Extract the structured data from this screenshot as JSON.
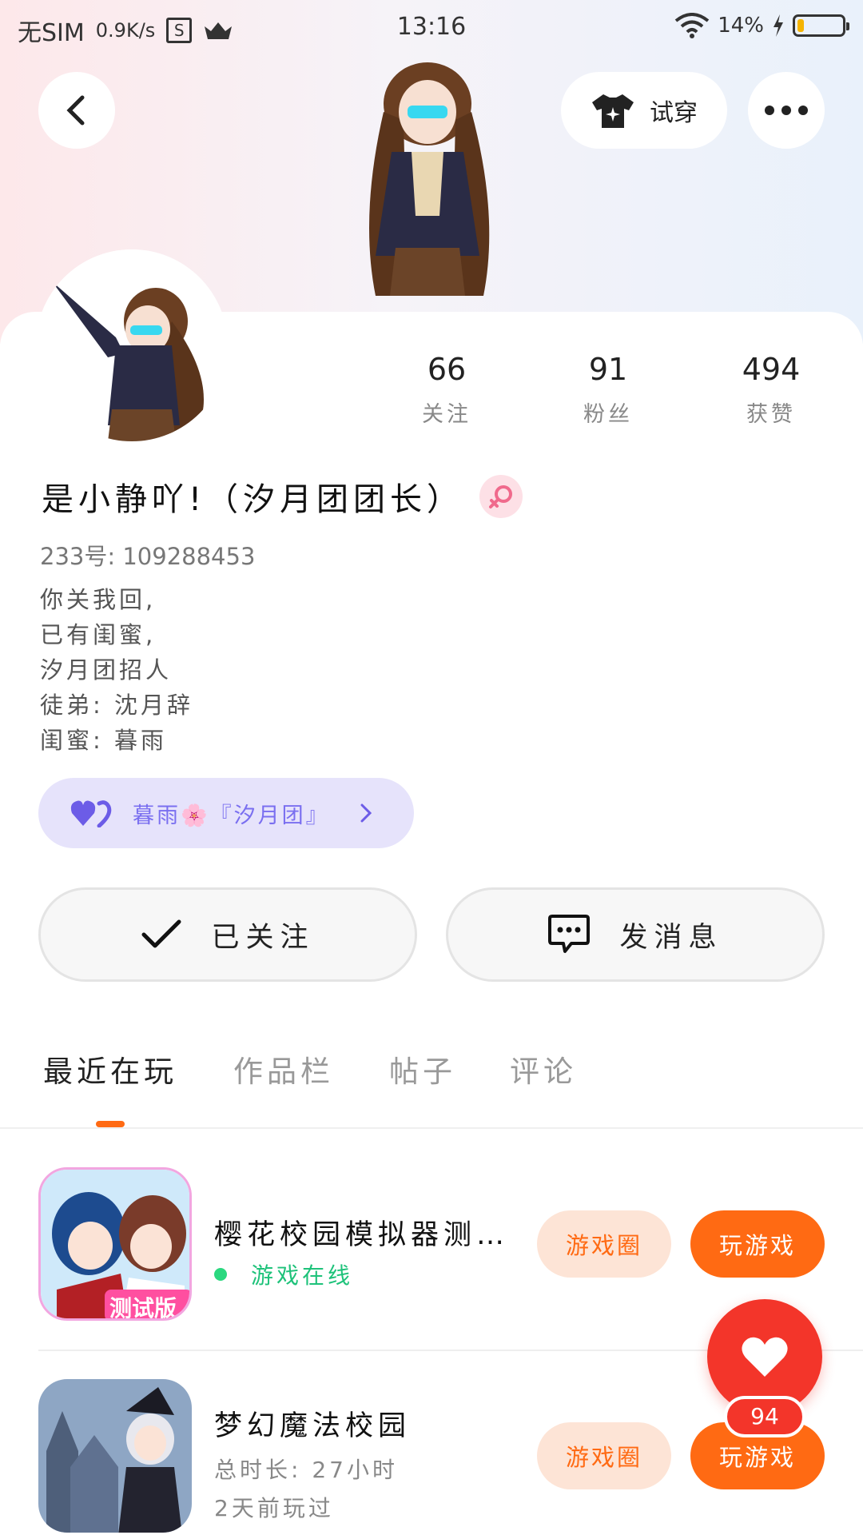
{
  "status_bar": {
    "carrier": "无SIM",
    "net_speed": "0.9K/s",
    "s_label": "S",
    "time": "13:16",
    "battery": "14%",
    "battery_level": 0.14
  },
  "header": {
    "try_on_label": "试穿"
  },
  "profile": {
    "stats": [
      {
        "value": "66",
        "label": "关注"
      },
      {
        "value": "91",
        "label": "粉丝"
      },
      {
        "value": "494",
        "label": "获赞"
      }
    ],
    "name": "是小静吖!（汐月团团长）",
    "uid": "233号: 109288453",
    "bio": [
      "你关我回,",
      "已有闺蜜,",
      "汐月团招人",
      "徒弟: 沈月辞",
      "闺蜜: 暮雨"
    ],
    "badge": "暮雨🌸『汐月团』"
  },
  "actions": {
    "follow": "已关注",
    "message": "发消息"
  },
  "tabs": [
    "最近在玩",
    "作品栏",
    "帖子",
    "评论"
  ],
  "games": [
    {
      "title": "樱花校园模拟器测…",
      "status": "游戏在线",
      "icon_banner": "测试版",
      "circle_label": "游戏圈",
      "play_label": "玩游戏"
    },
    {
      "title": "梦幻魔法校园",
      "playtime": "总时长: 27小时",
      "last_played": "2天前玩过",
      "circle_label": "游戏圈",
      "play_label": "玩游戏"
    }
  ],
  "likes": "94",
  "colors": {
    "accent": "#ff6a13",
    "like": "#f3352a",
    "badge_bg": "#e6e3fb",
    "online": "#1ec27a"
  }
}
